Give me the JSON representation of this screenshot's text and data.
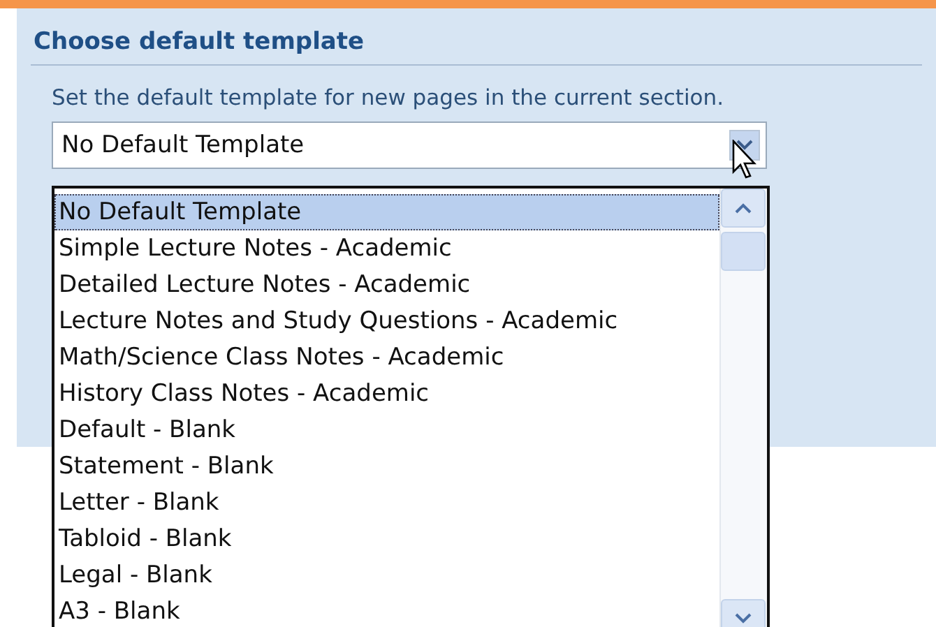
{
  "panel": {
    "title": "Choose default template",
    "description": "Set the default template for new pages in the current section."
  },
  "combo": {
    "value": "No Default Template",
    "expanded": true
  },
  "options": [
    {
      "label": "No Default Template",
      "selected": true
    },
    {
      "label": "Simple Lecture Notes - Academic",
      "selected": false
    },
    {
      "label": "Detailed Lecture Notes - Academic",
      "selected": false
    },
    {
      "label": "Lecture Notes and Study Questions - Academic",
      "selected": false
    },
    {
      "label": "Math/Science Class Notes - Academic",
      "selected": false
    },
    {
      "label": "History Class Notes - Academic",
      "selected": false
    },
    {
      "label": "Default - Blank",
      "selected": false
    },
    {
      "label": "Statement - Blank",
      "selected": false
    },
    {
      "label": "Letter - Blank",
      "selected": false
    },
    {
      "label": "Tabloid - Blank",
      "selected": false
    },
    {
      "label": "Legal - Blank",
      "selected": false
    },
    {
      "label": "A3 - Blank",
      "selected": false
    }
  ]
}
